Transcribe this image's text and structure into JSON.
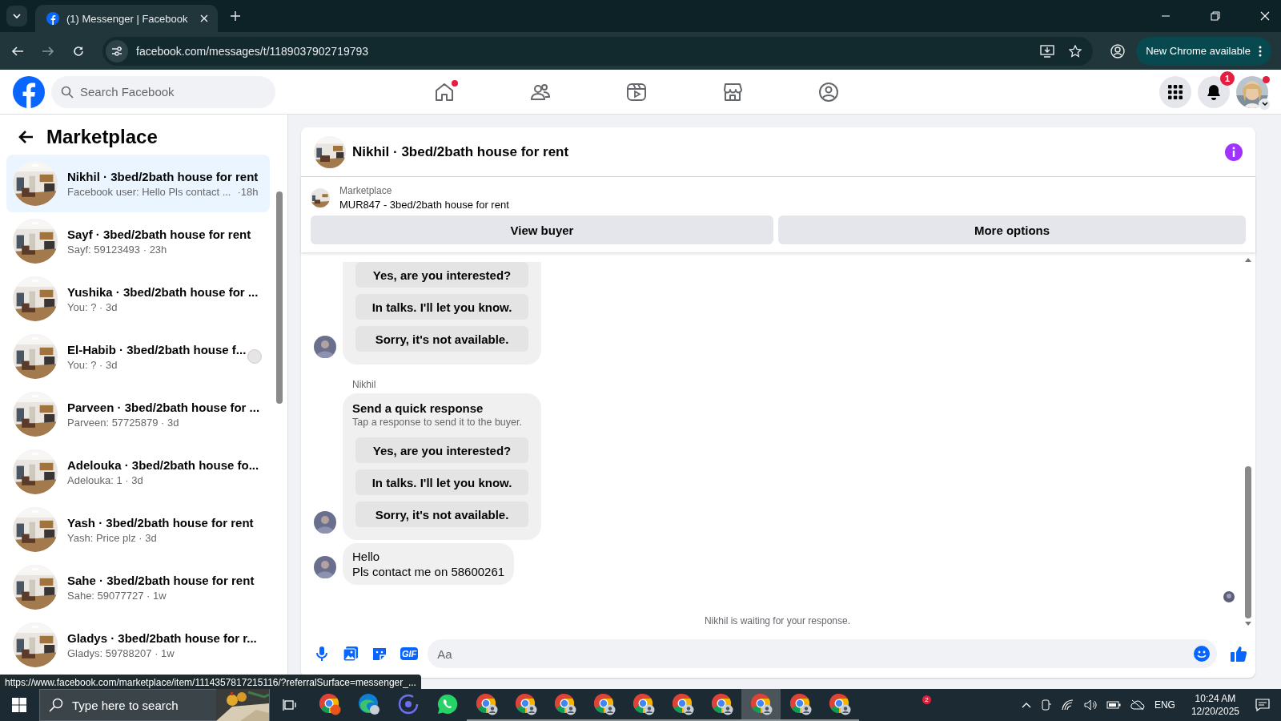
{
  "browser": {
    "tab_title": "(1) Messenger | Facebook",
    "address": "facebook.com/messages/t/1189037902719793",
    "update_label": "New Chrome available"
  },
  "header": {
    "search_placeholder": "Search Facebook",
    "notification_count": "1",
    "nav": [
      {
        "kind": "home",
        "dot": true
      },
      {
        "kind": "friends",
        "dot": false
      },
      {
        "kind": "video",
        "dot": false
      },
      {
        "kind": "marketplace",
        "dot": false
      },
      {
        "kind": "groups",
        "dot": false
      }
    ]
  },
  "sidebar": {
    "title": "Marketplace",
    "conversations": [
      {
        "title": "Nikhil · 3bed/2bath house for rent",
        "preview": "Facebook user: Hello Pls contact ...",
        "time": "·18h",
        "selected": true,
        "seen": false
      },
      {
        "title": "Sayf · 3bed/2bath house for rent",
        "preview": "Sayf: 59123493 · 23h",
        "selected": false,
        "seen": false
      },
      {
        "title": "Yushika · 3bed/2bath house for ...",
        "preview": "You: ? · 3d",
        "selected": false,
        "seen": false
      },
      {
        "title": "El-Habib · 3bed/2bath house f...",
        "preview": "You: ? · 3d",
        "selected": false,
        "seen": true
      },
      {
        "title": "Parveen · 3bed/2bath house for ...",
        "preview": "Parveen: 57725879 · 3d",
        "selected": false,
        "seen": false
      },
      {
        "title": "Adelouka · 3bed/2bath house fo...",
        "preview": "Adelouka: 1 · 3d",
        "selected": false,
        "seen": false
      },
      {
        "title": "Yash · 3bed/2bath house for rent",
        "preview": "Yash: Price plz · 3d",
        "selected": false,
        "seen": false
      },
      {
        "title": "Sahe · 3bed/2bath house for rent",
        "preview": "Sahe: 59077727 · 1w",
        "selected": false,
        "seen": false
      },
      {
        "title": "Gladys · 3bed/2bath house for r...",
        "preview": "Gladys: 59788207 · 1w",
        "selected": false,
        "seen": false
      }
    ]
  },
  "chat": {
    "title": "Nikhil · 3bed/2bath house for rent",
    "listing_label": "Marketplace",
    "listing_title": "MUR847 - 3bed/2bath house for rent",
    "buttons": [
      "View buyer",
      "More options"
    ],
    "messages": [
      {
        "kind": "quick_response",
        "options": [
          "Yes, are you interested?",
          "In talks. I'll let you know.",
          "Sorry, it's not available."
        ]
      },
      {
        "kind": "quick_response",
        "sender": "Nikhil",
        "heading": "Send a quick response",
        "hint": "Tap a response to send it to the buyer.",
        "options": [
          "Yes, are you interested?",
          "In talks. I'll let you know.",
          "Sorry, it's not available."
        ]
      },
      {
        "kind": "text",
        "lines": [
          "Hello",
          "Pls contact me on 58600261"
        ]
      }
    ],
    "status": "Nikhil is waiting for your response.",
    "gif_label": "GIF",
    "composer_placeholder": "Aa"
  },
  "status_url": "https://www.facebook.com/marketplace/item/1114357817215116/?referralSurface=messenger_...",
  "taskbar": {
    "search_placeholder": "Type here to search",
    "badge": "2",
    "apps": [
      {
        "kind": "chrome-w",
        "selected": false
      },
      {
        "kind": "edge",
        "selected": false
      },
      {
        "kind": "ring",
        "selected": false
      },
      {
        "kind": "whatsapp",
        "selected": false
      },
      {
        "kind": "chrome",
        "selected": false
      },
      {
        "kind": "chrome",
        "selected": false
      },
      {
        "kind": "chrome",
        "selected": false
      },
      {
        "kind": "chrome",
        "selected": false
      },
      {
        "kind": "chrome",
        "selected": false
      },
      {
        "kind": "chrome",
        "selected": false
      },
      {
        "kind": "chrome",
        "selected": false
      },
      {
        "kind": "chrome",
        "selected": true
      },
      {
        "kind": "chrome",
        "selected": false
      },
      {
        "kind": "chrome",
        "selected": false
      }
    ],
    "language": "ENG",
    "time": "10:24 AM",
    "date": "12/20/2025"
  }
}
